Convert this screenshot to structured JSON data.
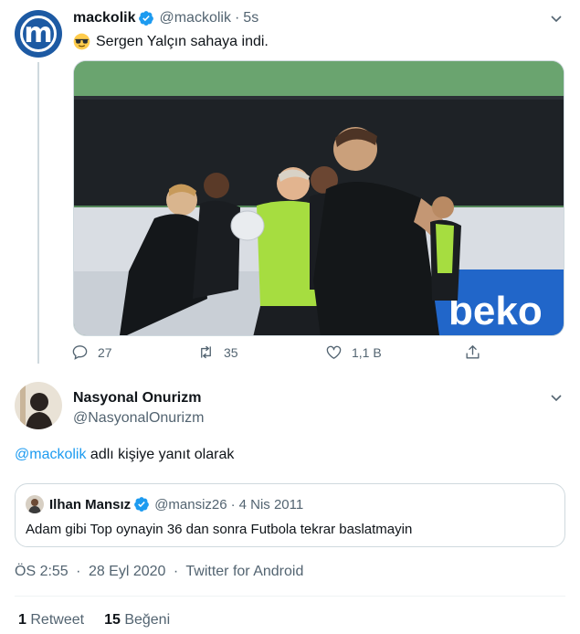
{
  "parent_tweet": {
    "author_name": "mackolik",
    "author_handle": "@mackolik",
    "time": "5s",
    "avatar_letter": "m",
    "emoji": "sunglasses-emoji",
    "text": "Sergen Yalçın sahaya indi.",
    "actions": {
      "replies": "27",
      "retweets": "35",
      "likes": "1,1 B"
    },
    "media_banner_text": "beko"
  },
  "reply": {
    "author_name": "Nasyonal Onurizm",
    "author_handle": "@NasyonalOnurizm",
    "reply_to_handle": "@mackolik",
    "reply_to_suffix": " adlı kişiye yanıt olarak"
  },
  "quoted_tweet": {
    "author_name": "Ilhan Mansız",
    "author_handle": "@mansiz26",
    "date": "4 Nis 2011",
    "text": "Adam gibi Top oynayin 36 dan sonra Futbola tekrar baslatmayin"
  },
  "meta": {
    "time": "ÖS 2:55",
    "date": "28 Eyl 2020",
    "source": "Twitter for Android"
  },
  "stats": {
    "retweet_count": "1",
    "retweet_label": "Retweet",
    "like_count": "15",
    "like_label": "Beğeni"
  },
  "colors": {
    "accent": "#1d9bf0",
    "text": "#0f1419",
    "muted": "#536471",
    "border": "#cfd9de",
    "brand_blue": "#1d5aa3"
  }
}
